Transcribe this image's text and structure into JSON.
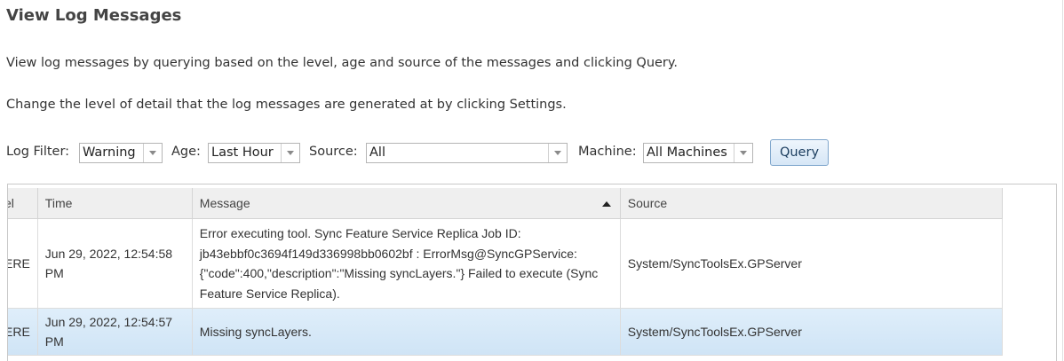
{
  "page": {
    "title": "View Log Messages",
    "desc1": "View log messages by querying based on the level, age and source of the messages and clicking Query.",
    "desc2": "Change the level of detail that the log messages are generated at by clicking Settings."
  },
  "filters": {
    "log_filter_label": "Log Filter:",
    "log_filter_value": "Warning",
    "age_label": "Age:",
    "age_value": "Last Hour",
    "source_label": "Source:",
    "source_value": "All",
    "machine_label": "Machine:",
    "machine_value": "All Machines",
    "query_label": "Query"
  },
  "table": {
    "columns": [
      "el",
      "Time",
      "Message",
      "Source"
    ],
    "sorted_column": "Message",
    "sort_direction": "ascending",
    "rows": [
      {
        "level": "ERE",
        "time": "Jun 29, 2022, 12:54:58 PM",
        "message": "Error executing tool. Sync Feature Service Replica Job ID: jb43ebbf0c3694f149d336998bb0602bf : ErrorMsg@SyncGPService: {\"code\":400,\"description\":\"Missing syncLayers.\"} Failed to execute (Sync Feature Service Replica).",
        "source": "System/SyncToolsEx.GPServer"
      },
      {
        "level": "ERE",
        "time": "Jun 29, 2022, 12:54:57 PM",
        "message": "Missing syncLayers.",
        "source": "System/SyncToolsEx.GPServer",
        "selected": true
      }
    ]
  },
  "colors": {
    "selected_row": "#d6e8f7",
    "header_bg": "#efefef",
    "query_border": "#7fa6cc"
  }
}
